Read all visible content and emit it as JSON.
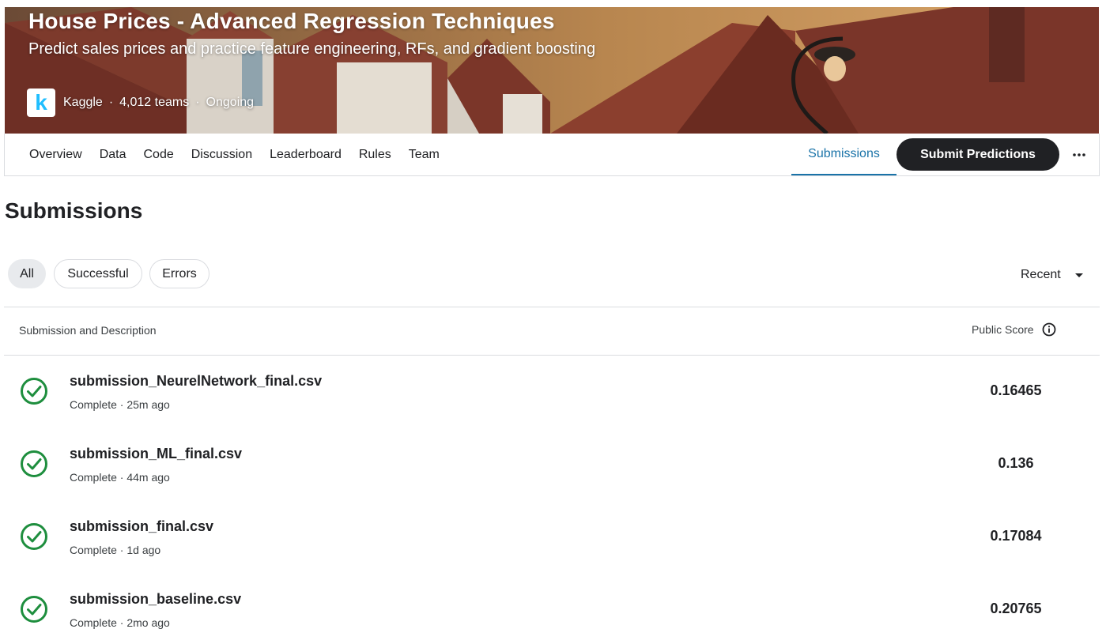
{
  "banner": {
    "title": "House Prices - Advanced Regression Techniques",
    "subtitle": "Predict sales prices and practice feature engineering, RFs, and gradient boosting",
    "host_logo_letter": "k",
    "host": "Kaggle",
    "teams": "4,012 teams",
    "status": "Ongoing",
    "separator": "·"
  },
  "nav": {
    "tabs": [
      "Overview",
      "Data",
      "Code",
      "Discussion",
      "Leaderboard",
      "Rules",
      "Team"
    ],
    "active_tab": "Submissions",
    "submit_label": "Submit Predictions",
    "more_icon": "more-horizontal-icon"
  },
  "page": {
    "title": "Submissions"
  },
  "filters": {
    "chips": [
      "All",
      "Successful",
      "Errors"
    ],
    "selected": "All",
    "sort_label": "Recent"
  },
  "table": {
    "col_submission": "Submission and Description",
    "col_score": "Public Score",
    "rows": [
      {
        "filename": "submission_NeurelNetwork_final.csv",
        "status": "Complete · 25m ago",
        "score": "0.16465"
      },
      {
        "filename": "submission_ML_final.csv",
        "status": "Complete · 44m ago",
        "score": "0.136"
      },
      {
        "filename": "submission_final.csv",
        "status": "Complete · 1d ago",
        "score": "0.17084"
      },
      {
        "filename": "submission_baseline.csv",
        "status": "Complete · 2mo ago",
        "score": "0.20765"
      }
    ]
  },
  "colors": {
    "accent": "#1a73a8",
    "success": "#1e8e3e",
    "dark_button": "#202124",
    "brand": "#20beff"
  }
}
